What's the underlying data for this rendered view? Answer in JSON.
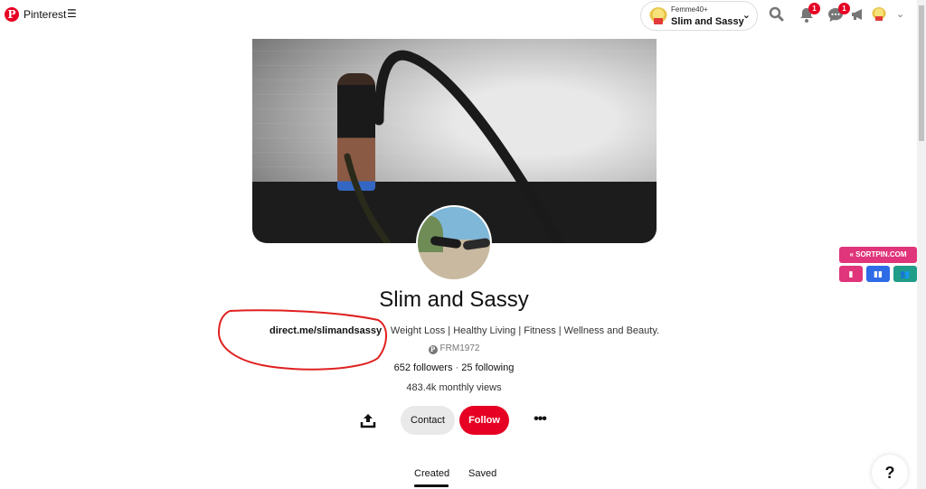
{
  "header": {
    "brand": "Pinterest",
    "account_switcher": {
      "small_label": "Femme40+",
      "name": "Slim and Sassy"
    },
    "badges": {
      "notifications": "1",
      "messages": "1"
    }
  },
  "profile": {
    "name": "Slim and Sassy",
    "website": "direct.me/slimandsassy",
    "bio": " · Weight Loss | Healthy Living | Fitness | Wellness and Beauty.",
    "handle": "FRM1972",
    "followers": "652 followers",
    "following": "25 following",
    "monthly_views": "483.4k monthly views"
  },
  "actions": {
    "contact": "Contact",
    "follow": "Follow",
    "more": "•••"
  },
  "tabs": [
    {
      "label": "Created",
      "active": true
    },
    {
      "label": "Saved",
      "active": false
    }
  ],
  "sortpin": {
    "label": "« SORTPIN.COM",
    "colors": {
      "pink": "#e0357a",
      "blue": "#2e6be6",
      "teal": "#1f9d88"
    }
  },
  "help": "?",
  "colors": {
    "brand_red": "#e60023",
    "annotation_red": "#e02020"
  }
}
